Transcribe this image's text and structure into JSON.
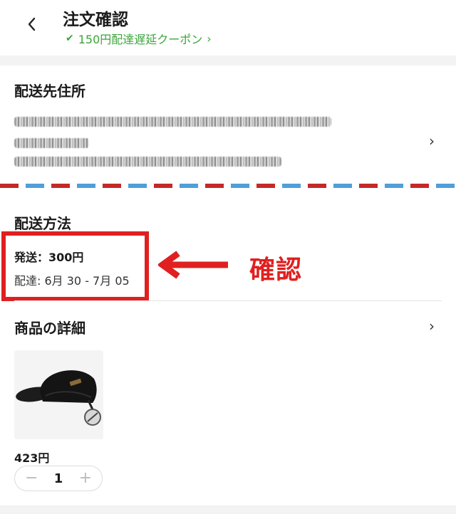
{
  "header": {
    "title": "注文確認",
    "coupon_text": "150円配達遅延クーポン"
  },
  "address": {
    "section_title": "配送先住所"
  },
  "shipping": {
    "section_title": "配送方法",
    "fee_text": "発送：300円",
    "date_text": "配達: 6月 30 - 7月 05"
  },
  "annotation": {
    "label": "確認",
    "color": "#e02020"
  },
  "product": {
    "section_title": "商品の詳細",
    "price": "423円",
    "quantity": "1",
    "minus": "−",
    "plus": "+"
  },
  "colors": {
    "coupon_green": "#3aa53a",
    "airmail_red": "#c62828",
    "airmail_blue": "#4f9fd8"
  }
}
